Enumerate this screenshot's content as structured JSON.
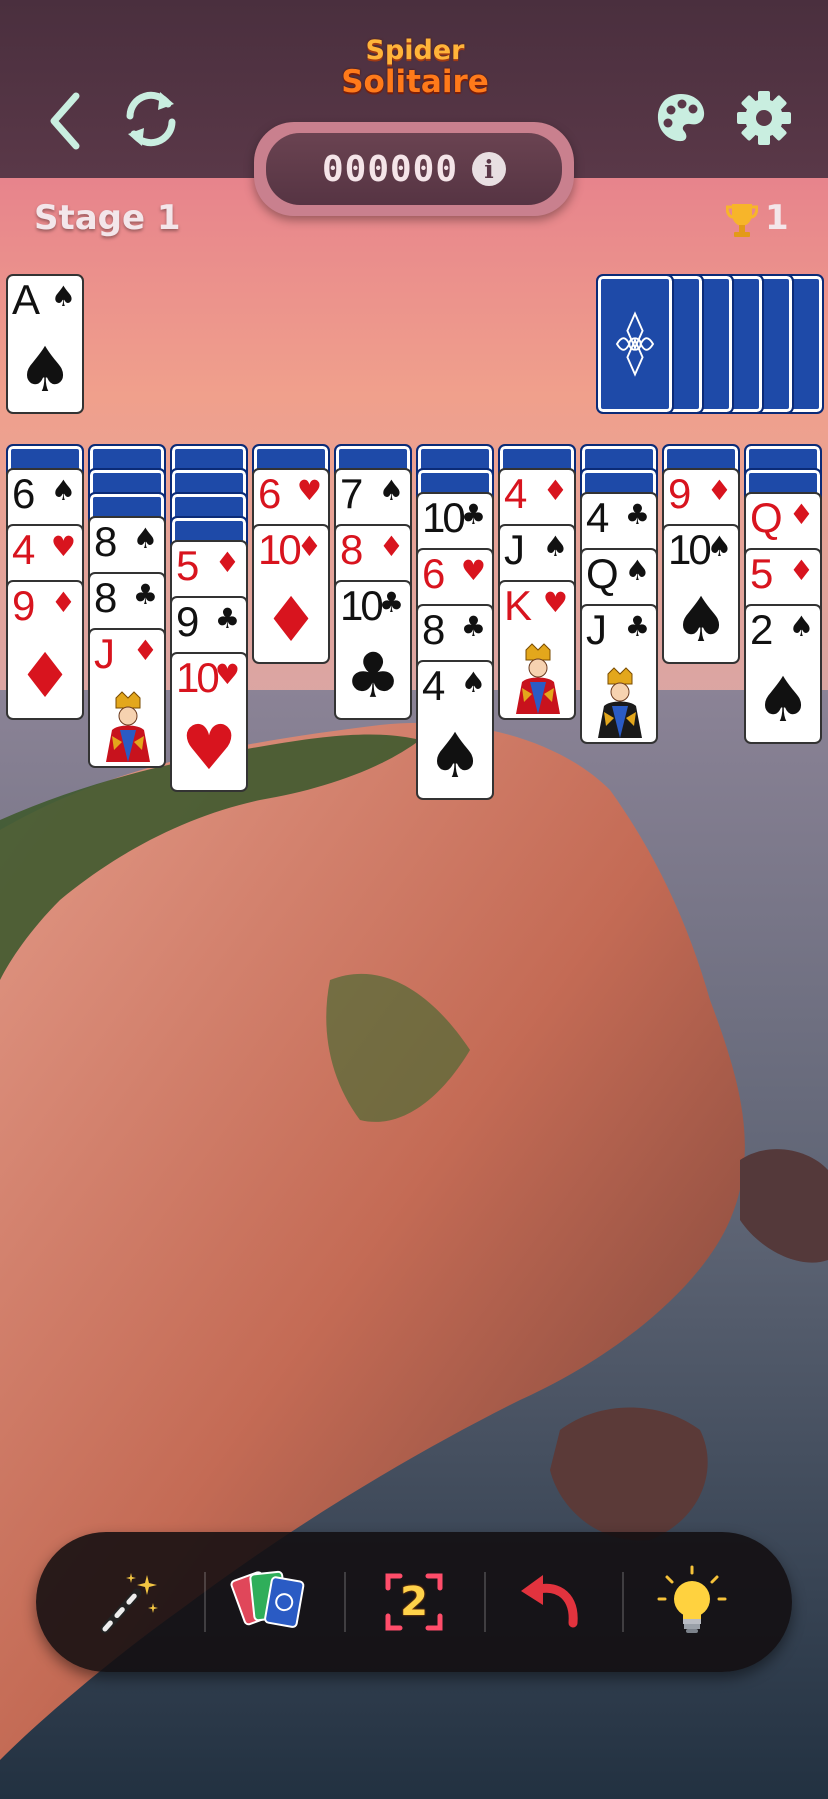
{
  "app": {
    "title_line1": "Spider",
    "title_line2": "Solitaire"
  },
  "header": {
    "score": "000000",
    "info_icon": "i",
    "stage_label": "Stage 1",
    "trophy_count": "1"
  },
  "foundation": [
    {
      "rank": "A",
      "suit": "♠",
      "color": "black"
    }
  ],
  "stock": {
    "piles": 6
  },
  "tableau": [
    {
      "hidden": 1,
      "cards": [
        {
          "rank": "6",
          "suit": "♠",
          "color": "black"
        },
        {
          "rank": "4",
          "suit": "♥",
          "color": "red"
        },
        {
          "rank": "9",
          "suit": "♦",
          "color": "red"
        }
      ]
    },
    {
      "hidden": 3,
      "cards": [
        {
          "rank": "8",
          "suit": "♠",
          "color": "black"
        },
        {
          "rank": "8",
          "suit": "♣",
          "color": "black"
        },
        {
          "rank": "J",
          "suit": "♦",
          "color": "red",
          "face": true
        }
      ]
    },
    {
      "hidden": 4,
      "cards": [
        {
          "rank": "5",
          "suit": "♦",
          "color": "red"
        },
        {
          "rank": "9",
          "suit": "♣",
          "color": "black"
        },
        {
          "rank": "10",
          "suit": "♥",
          "color": "red"
        }
      ]
    },
    {
      "hidden": 1,
      "cards": [
        {
          "rank": "6",
          "suit": "♥",
          "color": "red"
        },
        {
          "rank": "10",
          "suit": "♦",
          "color": "red"
        }
      ]
    },
    {
      "hidden": 1,
      "cards": [
        {
          "rank": "7",
          "suit": "♠",
          "color": "black"
        },
        {
          "rank": "8",
          "suit": "♦",
          "color": "red"
        },
        {
          "rank": "10",
          "suit": "♣",
          "color": "black"
        }
      ]
    },
    {
      "hidden": 2,
      "cards": [
        {
          "rank": "10",
          "suit": "♣",
          "color": "black"
        },
        {
          "rank": "6",
          "suit": "♥",
          "color": "red"
        },
        {
          "rank": "8",
          "suit": "♣",
          "color": "black"
        },
        {
          "rank": "4",
          "suit": "♠",
          "color": "black"
        }
      ]
    },
    {
      "hidden": 1,
      "cards": [
        {
          "rank": "4",
          "suit": "♦",
          "color": "red"
        },
        {
          "rank": "J",
          "suit": "♠",
          "color": "black"
        },
        {
          "rank": "K",
          "suit": "♥",
          "color": "red",
          "face": true
        }
      ]
    },
    {
      "hidden": 2,
      "cards": [
        {
          "rank": "4",
          "suit": "♣",
          "color": "black"
        },
        {
          "rank": "Q",
          "suit": "♠",
          "color": "black"
        },
        {
          "rank": "J",
          "suit": "♣",
          "color": "black",
          "face": true
        }
      ]
    },
    {
      "hidden": 1,
      "cards": [
        {
          "rank": "9",
          "suit": "♦",
          "color": "red"
        },
        {
          "rank": "10",
          "suit": "♠",
          "color": "black"
        }
      ]
    },
    {
      "hidden": 2,
      "cards": [
        {
          "rank": "Q",
          "suit": "♦",
          "color": "red"
        },
        {
          "rank": "5",
          "suit": "♦",
          "color": "red"
        },
        {
          "rank": "2",
          "suit": "♠",
          "color": "black"
        }
      ]
    }
  ],
  "toolbar": {
    "deal_count": "2"
  },
  "icons": {
    "back": "chevron-left-icon",
    "restart": "refresh-icon",
    "theme": "palette-icon",
    "settings": "gear-icon",
    "trophy": "trophy-icon",
    "magic": "magic-wand-icon",
    "cards": "card-deck-icon",
    "undo": "undo-arrow-icon",
    "hint": "lightbulb-icon"
  },
  "colors": {
    "accent": "#ff7a1a",
    "card_back": "#1e4aa8",
    "red_suit": "#d8141e"
  }
}
